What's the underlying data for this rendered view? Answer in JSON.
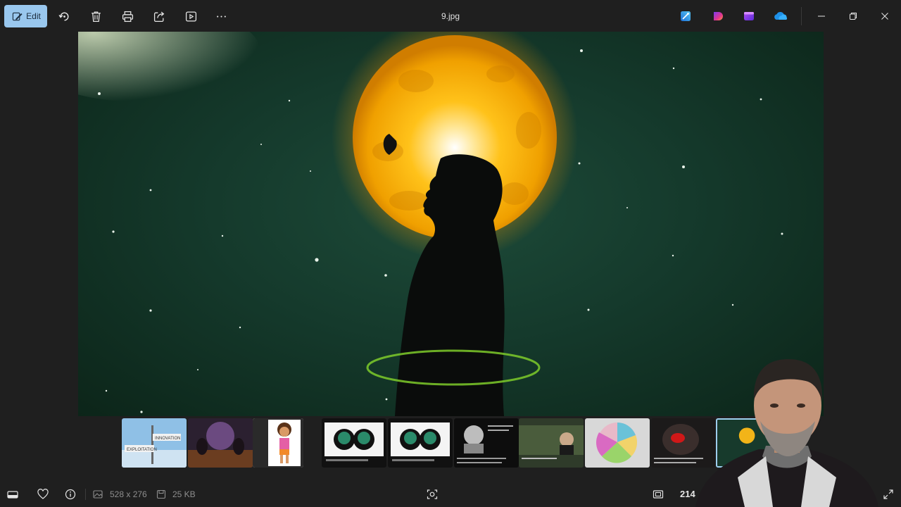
{
  "toolbar": {
    "edit_label": "Edit",
    "icons": [
      "edit-icon",
      "rotate-icon",
      "delete-icon",
      "print-icon",
      "share-icon",
      "slideshow-icon",
      "more-icon"
    ]
  },
  "window": {
    "title": "9.jpg",
    "app_icons": [
      "designer-icon",
      "clipchamp-icon",
      "clipchamp-video-icon",
      "onedrive-icon"
    ]
  },
  "filmstrip": {
    "thumbnails": [
      {
        "name": "exploitation-innovation-signs",
        "labels": [
          "INNOVATION",
          "EXPLOITATION"
        ]
      },
      {
        "name": "dinner-scene"
      },
      {
        "name": "dora-cartoon"
      },
      {
        "name": "two-heads-brain-1"
      },
      {
        "name": "two-heads-brain-2"
      },
      {
        "name": "man-portrait-text"
      },
      {
        "name": "matrix-scene"
      },
      {
        "name": "colorful-wheel"
      },
      {
        "name": "dark-figure-red"
      },
      {
        "name": "9.jpg",
        "selected": true
      }
    ]
  },
  "bottombar": {
    "dimensions": "528 x 276",
    "file_size": "25 KB",
    "zoom": "214"
  },
  "colors": {
    "accent": "#99c7ee",
    "background": "#1f1f1f"
  }
}
